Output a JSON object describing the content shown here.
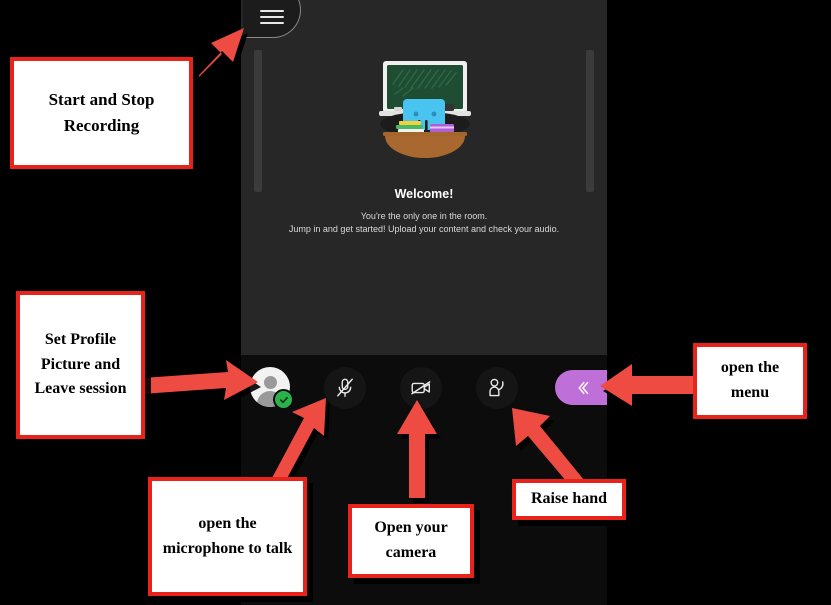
{
  "app": {
    "menu_button": "hamburger-menu",
    "welcome": {
      "title": "Welcome!",
      "line1": "You're the only one in the room.",
      "line2": "Jump in and get started! Upload your content and check your audio."
    },
    "controls": [
      {
        "name": "profile-avatar",
        "icon": "user-avatar-icon",
        "status": "online"
      },
      {
        "name": "microphone",
        "icon": "microphone-muted-icon"
      },
      {
        "name": "camera",
        "icon": "camera-off-icon"
      },
      {
        "name": "raise-hand",
        "icon": "raise-hand-icon"
      }
    ],
    "menu_toggle": {
      "icon": "double-chevron-left-icon"
    }
  },
  "annotations": [
    {
      "id": "recording",
      "text": "Start and Stop Recording"
    },
    {
      "id": "profile",
      "text": "Set Profile Picture and Leave session"
    },
    {
      "id": "microphone",
      "text": "open the microphone to talk"
    },
    {
      "id": "camera",
      "text": "Open your camera"
    },
    {
      "id": "raisehand",
      "text": "Raise hand"
    },
    {
      "id": "menu",
      "text": "open the menu"
    }
  ],
  "colors": {
    "annotation_border": "#e8231b",
    "arrow": "#ee4b42",
    "menu_toggle": "#be6fd8",
    "status_online": "#2bb24c",
    "stage_bg": "#272727",
    "bar_bg": "#0c0c0c"
  }
}
